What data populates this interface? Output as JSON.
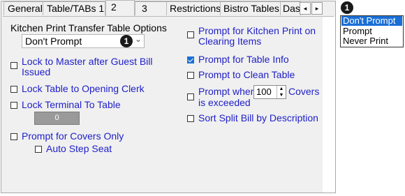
{
  "tabs": [
    {
      "label": "General"
    },
    {
      "label": "Table/TABs 1"
    },
    {
      "label": "2"
    },
    {
      "label": "3"
    },
    {
      "label": "Restrictions"
    },
    {
      "label": "Bistro Tables"
    },
    {
      "label": "Das"
    }
  ],
  "scroll": {
    "left": "◂",
    "right": "▸"
  },
  "kitchen": {
    "label": "Kitchen Print Transfer Table Options",
    "value": "Don't Prompt",
    "badge": "1",
    "arrow": "⌄"
  },
  "left_options": {
    "lock_master": "Lock to Master after Guest Bill",
    "lock_master_2": "Issued",
    "lock_clerk": "Lock Table to Opening Clerk",
    "lock_terminal": "Lock Terminal To Table",
    "terminal_value": "0",
    "covers_only": "Prompt for Covers Only",
    "auto_step": "Auto Step Seat"
  },
  "right_options": {
    "kitchen_clear_1": "Prompt for Kitchen Print on",
    "kitchen_clear_2": "Clearing Items",
    "table_info": "Prompt for Table Info",
    "clean_table": "Prompt to Clean Table",
    "covers_when": "Prompt when",
    "covers_value": "100",
    "covers_suffix": "Covers",
    "covers_exceeded": "is exceeded",
    "sort_split": "Sort Split Bill by Description"
  },
  "dropdown": {
    "badge": "1",
    "options": [
      "Don't Prompt",
      "Prompt",
      "Never Print"
    ]
  },
  "colors": {
    "accent": "#1a6fd6",
    "link_text": "#1e1ec8"
  }
}
